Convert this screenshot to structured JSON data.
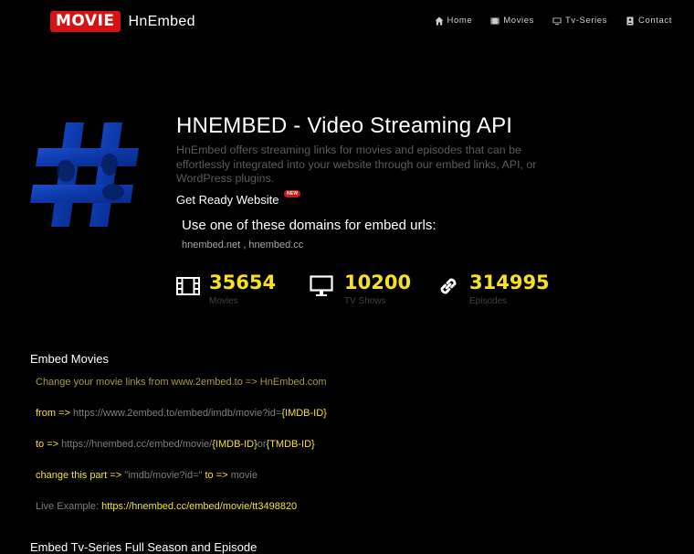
{
  "nav": {
    "brand_badge": "MOVIE",
    "brand_name": "HnEmbed",
    "items": [
      {
        "label": "Home",
        "icon": "home-icon"
      },
      {
        "label": "Movies",
        "icon": "film-icon"
      },
      {
        "label": "Tv-Series",
        "icon": "tv-icon"
      },
      {
        "label": "Contact",
        "icon": "contact-icon"
      }
    ]
  },
  "hero": {
    "title": "HNEMBED - Video Streaming API",
    "description": "HnEmbed offers streaming links for movies and episodes that can be effortlessly integrated into your website through our embed links, API, or WordPress plugins.",
    "get_ready": "Get Ready Website",
    "new_badge": "NEW",
    "domains_title": "Use one of these domains for embed urls:",
    "domains": "hnembed.net , hnembed.cc"
  },
  "stats": [
    {
      "value": "35654",
      "label": "Movies",
      "icon": "film-strip-icon"
    },
    {
      "value": "10200",
      "label": "TV Shows",
      "icon": "monitor-icon"
    },
    {
      "value": "314995",
      "label": "Episodes",
      "icon": "link-icon"
    }
  ],
  "embed_movies": {
    "heading": "Embed Movies",
    "change_line": "Change your movie links from www.2embed.to => HnEmbed.com",
    "from_label": "from =>",
    "from_url": "https://www.2embed.to/embed/imdb/movie?id=",
    "from_param": "{IMDB-ID}",
    "to_label": "to =>",
    "to_url": "https://hnembed.cc/embed/movie/",
    "to_param1": "{IMDB-ID}",
    "to_or": "or",
    "to_param2": "{TMDB-ID}",
    "change_part_label": "change this part =>",
    "change_part_from": "\"imdb/movie?id=\"",
    "change_part_to_label": "to =>",
    "change_part_to": "movie",
    "live_label": "Live Example:",
    "live_url": "https://hnembed.cc/embed/movie/tt3498820"
  },
  "embed_tv": {
    "heading": "Embed Tv-Series Full Season and Episode"
  },
  "colors": {
    "accent_red": "#d41414",
    "stat_yellow": "#f7e21b",
    "background": "#000000"
  }
}
